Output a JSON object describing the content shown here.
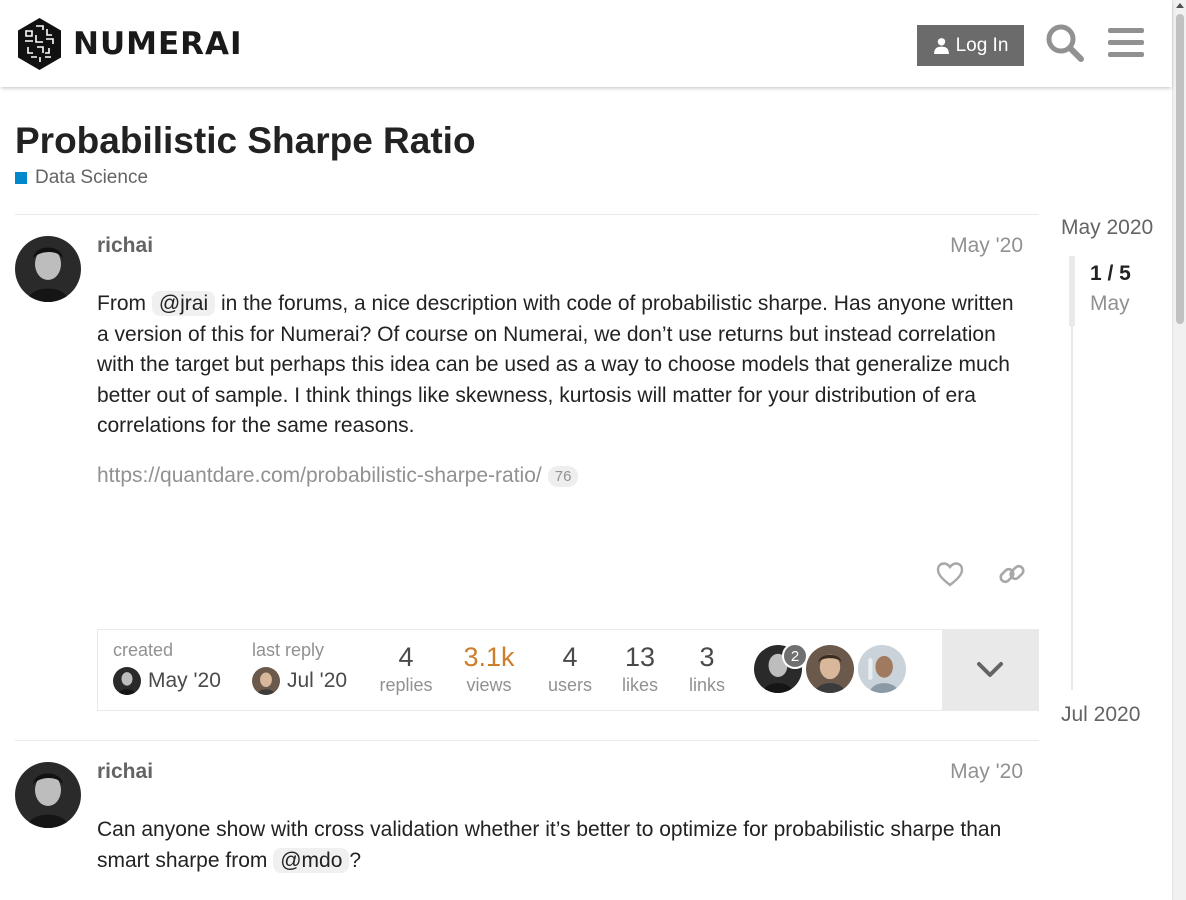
{
  "header": {
    "logo_text": "NUMERAI",
    "login_label": "Log In",
    "icons": [
      "user-icon",
      "search-icon",
      "hamburger-menu-icon"
    ]
  },
  "topic": {
    "title": "Probabilistic Sharpe Ratio",
    "category": "Data Science",
    "category_color": "#0088cc"
  },
  "posts": [
    {
      "username": "richai",
      "date": "May '20",
      "body_parts": [
        "From ",
        "@jrai",
        " in the forums, a nice description with code of probabilistic sharpe. Has anyone written a version of this for Numerai? Of course on Numerai, we don’t use returns but instead correlation with the target but perhaps this idea can be used as a way to choose models that generalize much better out of sample. I think things like skewness, kurtosis will matter for your distribution of era correlations for the same reasons."
      ],
      "link": "https://quantdare.com/probabilistic-sharpe-ratio/",
      "link_clicks": "76",
      "actions": [
        "heart-icon",
        "link-icon"
      ]
    },
    {
      "username": "richai",
      "date": "May '20",
      "body_parts": [
        "Can anyone show with cross validation whether it’s better to optimize for probabilistic sharpe than smart sharpe from ",
        "@mdo",
        "?"
      ]
    }
  ],
  "topic_map": {
    "created_label": "created",
    "created_date": "May '20",
    "last_reply_label": "last reply",
    "last_reply_date": "Jul '20",
    "stats": [
      {
        "value": "4",
        "label": "replies"
      },
      {
        "value": "3.1k",
        "label": "views"
      },
      {
        "value": "4",
        "label": "users"
      },
      {
        "value": "13",
        "label": "likes"
      },
      {
        "value": "3",
        "label": "links"
      }
    ],
    "participant_post_count": "2",
    "views_color": "#ce7e2b"
  },
  "timeline": {
    "start": "May 2020",
    "position": "1 / 5",
    "position_date": "May",
    "end": "Jul 2020"
  }
}
